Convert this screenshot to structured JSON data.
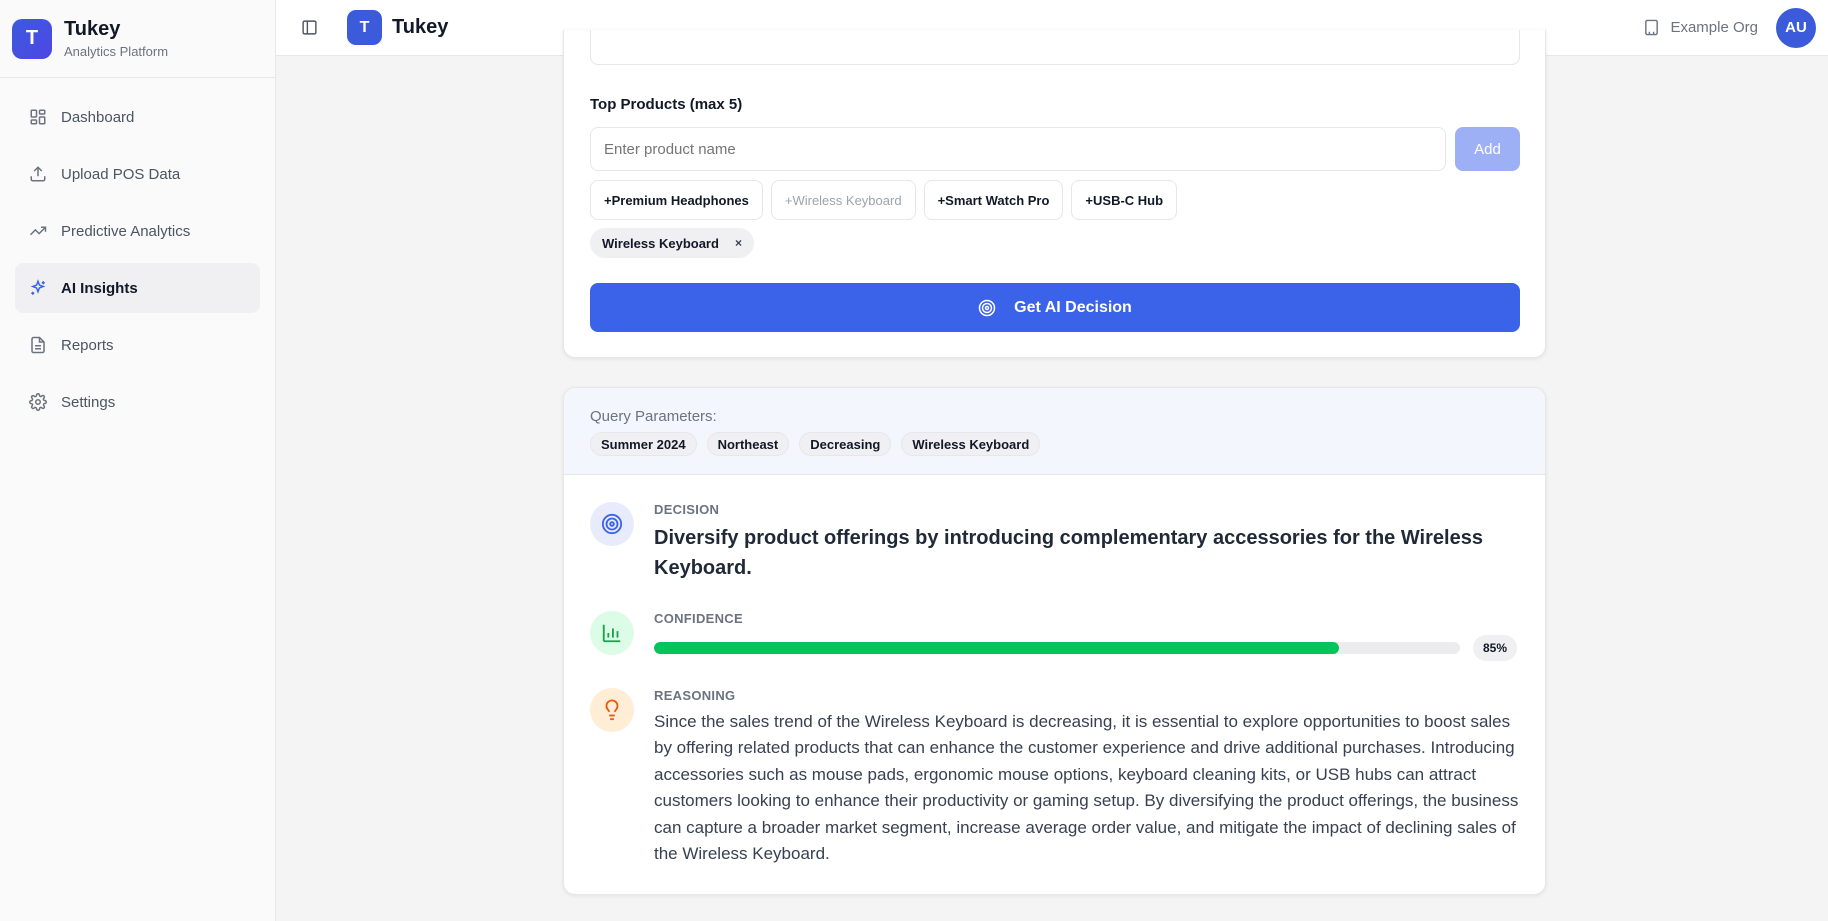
{
  "brand": {
    "logo_letter": "T",
    "name": "Tukey",
    "subtitle": "Analytics Platform"
  },
  "sidebar": {
    "items": [
      {
        "label": "Dashboard",
        "icon": "dashboard-icon",
        "active": false
      },
      {
        "label": "Upload POS Data",
        "icon": "upload-icon",
        "active": false
      },
      {
        "label": "Predictive Analytics",
        "icon": "trending-up-icon",
        "active": false
      },
      {
        "label": "AI Insights",
        "icon": "sparkles-icon",
        "active": true
      },
      {
        "label": "Reports",
        "icon": "file-text-icon",
        "active": false
      },
      {
        "label": "Settings",
        "icon": "gear-icon",
        "active": false
      }
    ]
  },
  "header": {
    "logo_letter": "T",
    "title": "Tukey",
    "org": "Example Org",
    "avatar_initials": "AU"
  },
  "form": {
    "top_products_label": "Top Products (max 5)",
    "product_input_placeholder": "Enter product name",
    "add_label": "Add",
    "suggestions": [
      {
        "label": "+Premium Headphones",
        "disabled": false
      },
      {
        "label": "+Wireless Keyboard",
        "disabled": true
      },
      {
        "label": "+Smart Watch Pro",
        "disabled": false
      },
      {
        "label": "+USB-C Hub",
        "disabled": false
      }
    ],
    "selected": [
      {
        "label": "Wireless Keyboard",
        "remove": "×"
      }
    ],
    "submit_label": "Get AI Decision"
  },
  "result": {
    "query_label": "Query Parameters:",
    "query_params": [
      "Summer 2024",
      "Northeast",
      "Decreasing",
      "Wireless Keyboard"
    ],
    "decision_label": "DECISION",
    "decision_text": "Diversify product offerings by introducing complementary accessories for the Wireless Keyboard.",
    "confidence_label": "CONFIDENCE",
    "confidence_value": 0.85,
    "confidence_text": "85%",
    "reasoning_label": "REASONING",
    "reasoning_text": "Since the sales trend of the Wireless Keyboard is decreasing, it is essential to explore opportunities to boost sales by offering related products that can enhance the customer experience and drive additional purchases. Introducing accessories such as mouse pads, ergonomic mouse options, keyboard cleaning kits, or USB hubs can attract customers looking to enhance their productivity or gaming setup. By diversifying the product offerings, the business can capture a broader market segment, increase average order value, and mitigate the impact of declining sales of the Wireless Keyboard."
  },
  "colors": {
    "primary": "#3b63ea",
    "primary_disabled": "#9db0f5",
    "confidence_fill": "#05c45b",
    "decision_icon_bg": "#e8ebfb",
    "confidence_icon_bg": "#dcfce7",
    "reasoning_icon_bg": "#ffedd5"
  }
}
